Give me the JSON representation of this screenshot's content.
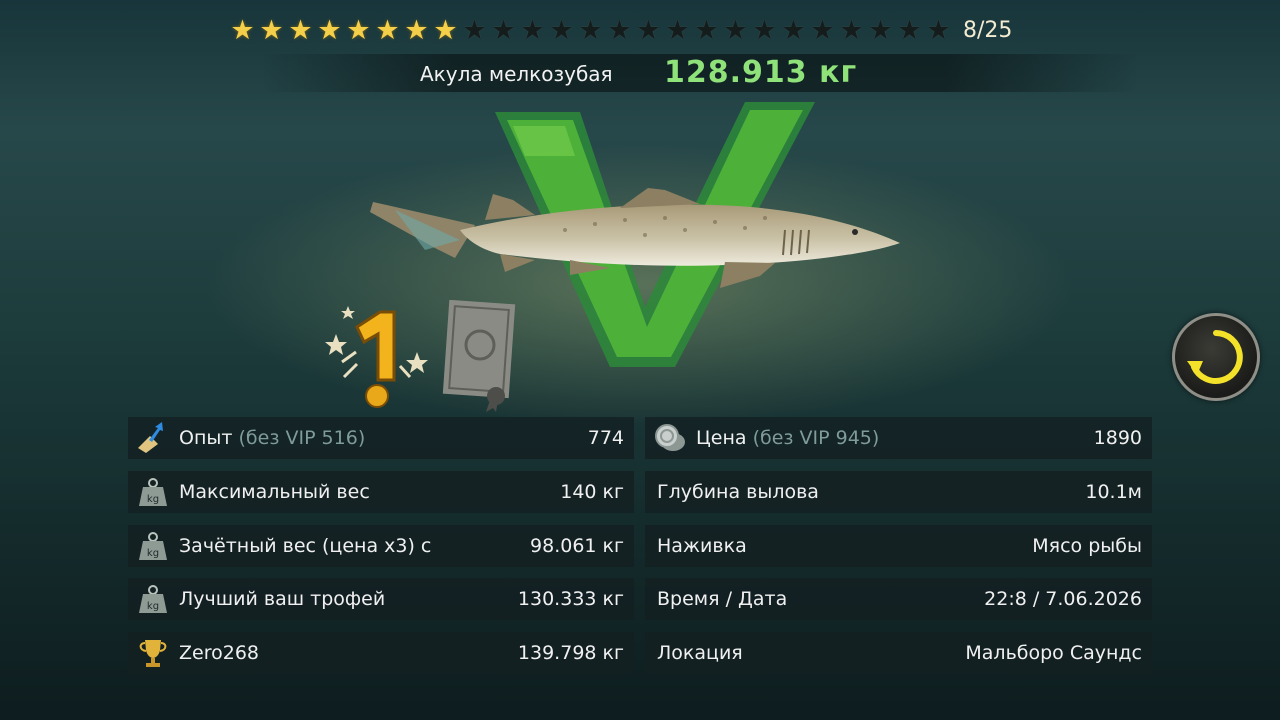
{
  "rating": {
    "filled": 8,
    "total": 25,
    "counter": "8/25"
  },
  "catch": {
    "species": "Акула мелкозубая",
    "weight": "128.913 кг"
  },
  "replay_icon": "replay-icon",
  "colors": {
    "accent_green": "#8fe27a",
    "record_yellow": "#f4ec5a",
    "star_gold": "#f4cf4a"
  },
  "stats_left": [
    {
      "icon": "xp-arrow-icon",
      "label": "Опыт",
      "sublabel": "(без VIP 516)",
      "value": "774"
    },
    {
      "icon": "weight-icon",
      "label": "Максимальный вес",
      "value": "140 кг"
    },
    {
      "icon": "weight-icon",
      "label": "Зачётный вес (цена х3) с",
      "value": "98.061 кг"
    },
    {
      "icon": "weight-icon",
      "label": "Лучший ваш трофей",
      "value": "130.333 кг"
    },
    {
      "icon": "trophy-icon",
      "label": "Zero268",
      "value": "139.798 кг"
    }
  ],
  "stats_right": [
    {
      "icon": "coin-icon",
      "label": "Цена",
      "sublabel": "(без VIP 945)",
      "value": "1890"
    },
    {
      "label": "Глубина вылова",
      "value": "10.1м"
    },
    {
      "label": "Наживка",
      "value": "Мясо рыбы"
    },
    {
      "label": "Время / Дата",
      "value": "22:8 / 7.06.2026"
    },
    {
      "label": "Локация",
      "value": "Мальборо Саундс"
    }
  ]
}
